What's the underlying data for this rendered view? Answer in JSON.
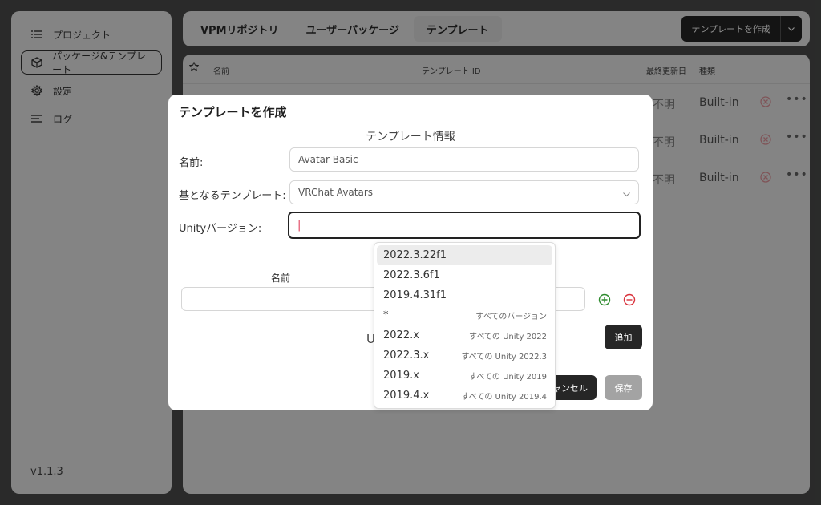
{
  "sidebar": {
    "items": [
      {
        "label": "プロジェクト",
        "icon": "list-icon"
      },
      {
        "label": "パッケージ&テンプレート",
        "icon": "package-icon"
      },
      {
        "label": "設定",
        "icon": "gear-icon"
      },
      {
        "label": "ログ",
        "icon": "log-lines-icon"
      }
    ],
    "active_index": 1,
    "version": "v1.1.3"
  },
  "tabs": [
    "VPMリポジトリ",
    "ユーザーパッケージ",
    "テンプレート"
  ],
  "active_tab": 2,
  "create_button": {
    "label": "テンプレートを作成"
  },
  "table": {
    "headers": {
      "name": "名前",
      "template_id": "テンプレート ID",
      "last_updated": "最終更新日",
      "type": "種類"
    },
    "rows": [
      {
        "date": "不明",
        "type": "Built-in"
      },
      {
        "date": "不明",
        "type": "Built-in"
      },
      {
        "date": "不明",
        "type": "Built-in"
      }
    ]
  },
  "dialog": {
    "title": "テンプレートを作成",
    "section_title": "テンプレート情報",
    "fields": {
      "name_label": "名前:",
      "name_value": "Avatar Basic",
      "base_label": "基となるテンプレート:",
      "base_value": "VRChat Avatars",
      "unity_label": "Unityバージョン:",
      "unity_value": "|"
    },
    "packages": {
      "name_col": "名前",
      "partial_heading": "U"
    },
    "add_label": "追加",
    "cancel_label": "ャンセル",
    "save_label": "保存"
  },
  "dropdown": {
    "options": [
      {
        "value": "2022.3.22f1",
        "desc": ""
      },
      {
        "value": "2022.3.6f1",
        "desc": ""
      },
      {
        "value": "2019.4.31f1",
        "desc": ""
      },
      {
        "value": "*",
        "desc": "すべてのバージョン"
      },
      {
        "value": "2022.x",
        "desc": "すべての Unity 2022"
      },
      {
        "value": "2022.3.x",
        "desc": "すべての Unity 2022.3"
      },
      {
        "value": "2019.x",
        "desc": "すべての Unity 2019"
      },
      {
        "value": "2019.4.x",
        "desc": "すべての Unity 2019.4"
      }
    ],
    "highlighted_index": 0
  },
  "colors": {
    "add_icon": "#2e8b2e",
    "remove_icon": "#d9303a",
    "remove_row_icon": "#e89aa0",
    "cursor": "#e0405a"
  }
}
